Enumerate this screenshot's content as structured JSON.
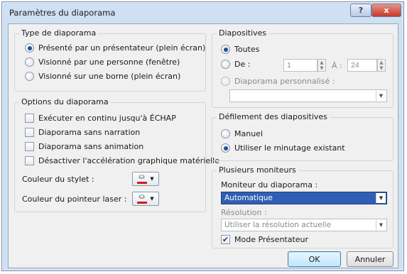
{
  "window": {
    "title": "Paramètres du diaporama",
    "help_glyph": "?",
    "close_glyph": "x"
  },
  "type_group": {
    "title": "Type de diaporama",
    "options": [
      {
        "label": "Présenté par un présentateur (plein écran)",
        "checked": true
      },
      {
        "label": "Visionné par une personne (fenêtre)",
        "checked": false
      },
      {
        "label": "Visionné sur une borne (plein écran)",
        "checked": false
      }
    ]
  },
  "options_group": {
    "title": "Options du diaporama",
    "checks": [
      {
        "label": "Exécuter en continu jusqu'à ÉCHAP",
        "checked": false
      },
      {
        "label": "Diaporama sans narration",
        "checked": false
      },
      {
        "label": "Diaporama sans animation",
        "checked": false
      },
      {
        "label": "Désactiver l'accélération graphique matérielle",
        "checked": false
      }
    ],
    "pen_color_label": "Couleur du stylet :",
    "laser_color_label": "Couleur du pointeur laser :",
    "pen_color": "#d11d1d",
    "laser_color": "#d11d1d"
  },
  "slides_group": {
    "title": "Diapositives",
    "all_label": "Toutes",
    "from_label": "De :",
    "from_value": "1",
    "to_label": "À :",
    "to_value": "24",
    "custom_label": "Diaporama personnalisé :",
    "custom_value": ""
  },
  "advance_group": {
    "title": "Défilement des diapositives",
    "manual_label": "Manuel",
    "timing_label": "Utiliser le minutage existant"
  },
  "monitors_group": {
    "title": "Plusieurs moniteurs",
    "monitor_label": "Moniteur du diaporama :",
    "monitor_value": "Automatique",
    "resolution_label": "Résolution :",
    "resolution_value": "Utiliser la résolution actuelle",
    "presenter_label": "Mode Présentateur",
    "presenter_checked": true
  },
  "buttons": {
    "ok": "OK",
    "cancel": "Annuler"
  }
}
